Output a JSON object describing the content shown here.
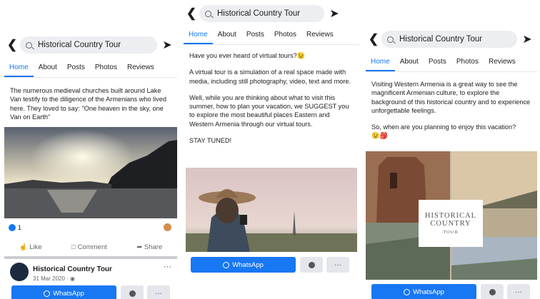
{
  "search": {
    "text": "Historical Country Tour"
  },
  "tabs": [
    "Home",
    "About",
    "Posts",
    "Photos",
    "Reviews"
  ],
  "p1": {
    "caption": "The numerous medieval churches built around Lake Van testify to the diligence of the Armenians who lived here. They loved to say: \"One heaven in the sky, one Van on Earth\"",
    "reactions": "1",
    "like": "Like",
    "comment": "Comment",
    "share": "Share",
    "author": "Historical Country Tour",
    "date": "31 Mar 2020 · ",
    "whatsapp": "WhatsApp",
    "more": "···"
  },
  "p2": {
    "para1": "Have you ever heard of virtual tours?😉",
    "para2": "A virtual tour is a simulation of a real space made with media, including still photography, video, text and more.",
    "para3": "Well, while you are thinking about  what to visit this summer, how to plan your vacation, we SUGGEST you to explore the most beautiful places Eastern and Western Armenia through our virtual tours.",
    "para4": "STAY TUNED!",
    "whatsapp": "WhatsApp",
    "more": "···"
  },
  "p3": {
    "para1": "Visiting Western Armenia is a great way to see the magnificent Armenian culture, to explore the background of this historical country and to experience unforgettable feelings.",
    "para2": "So, when are you planning to enjoy this vacation?",
    "emoji": "😉🎒",
    "overlay_line1": "HISTORICAL",
    "overlay_line2": "COUNTRY",
    "overlay_line3": "TOUR",
    "whatsapp": "WhatsApp",
    "more": "···"
  },
  "colors": {
    "accent": "#1877f2",
    "tab_border": "#e4e6eb"
  }
}
